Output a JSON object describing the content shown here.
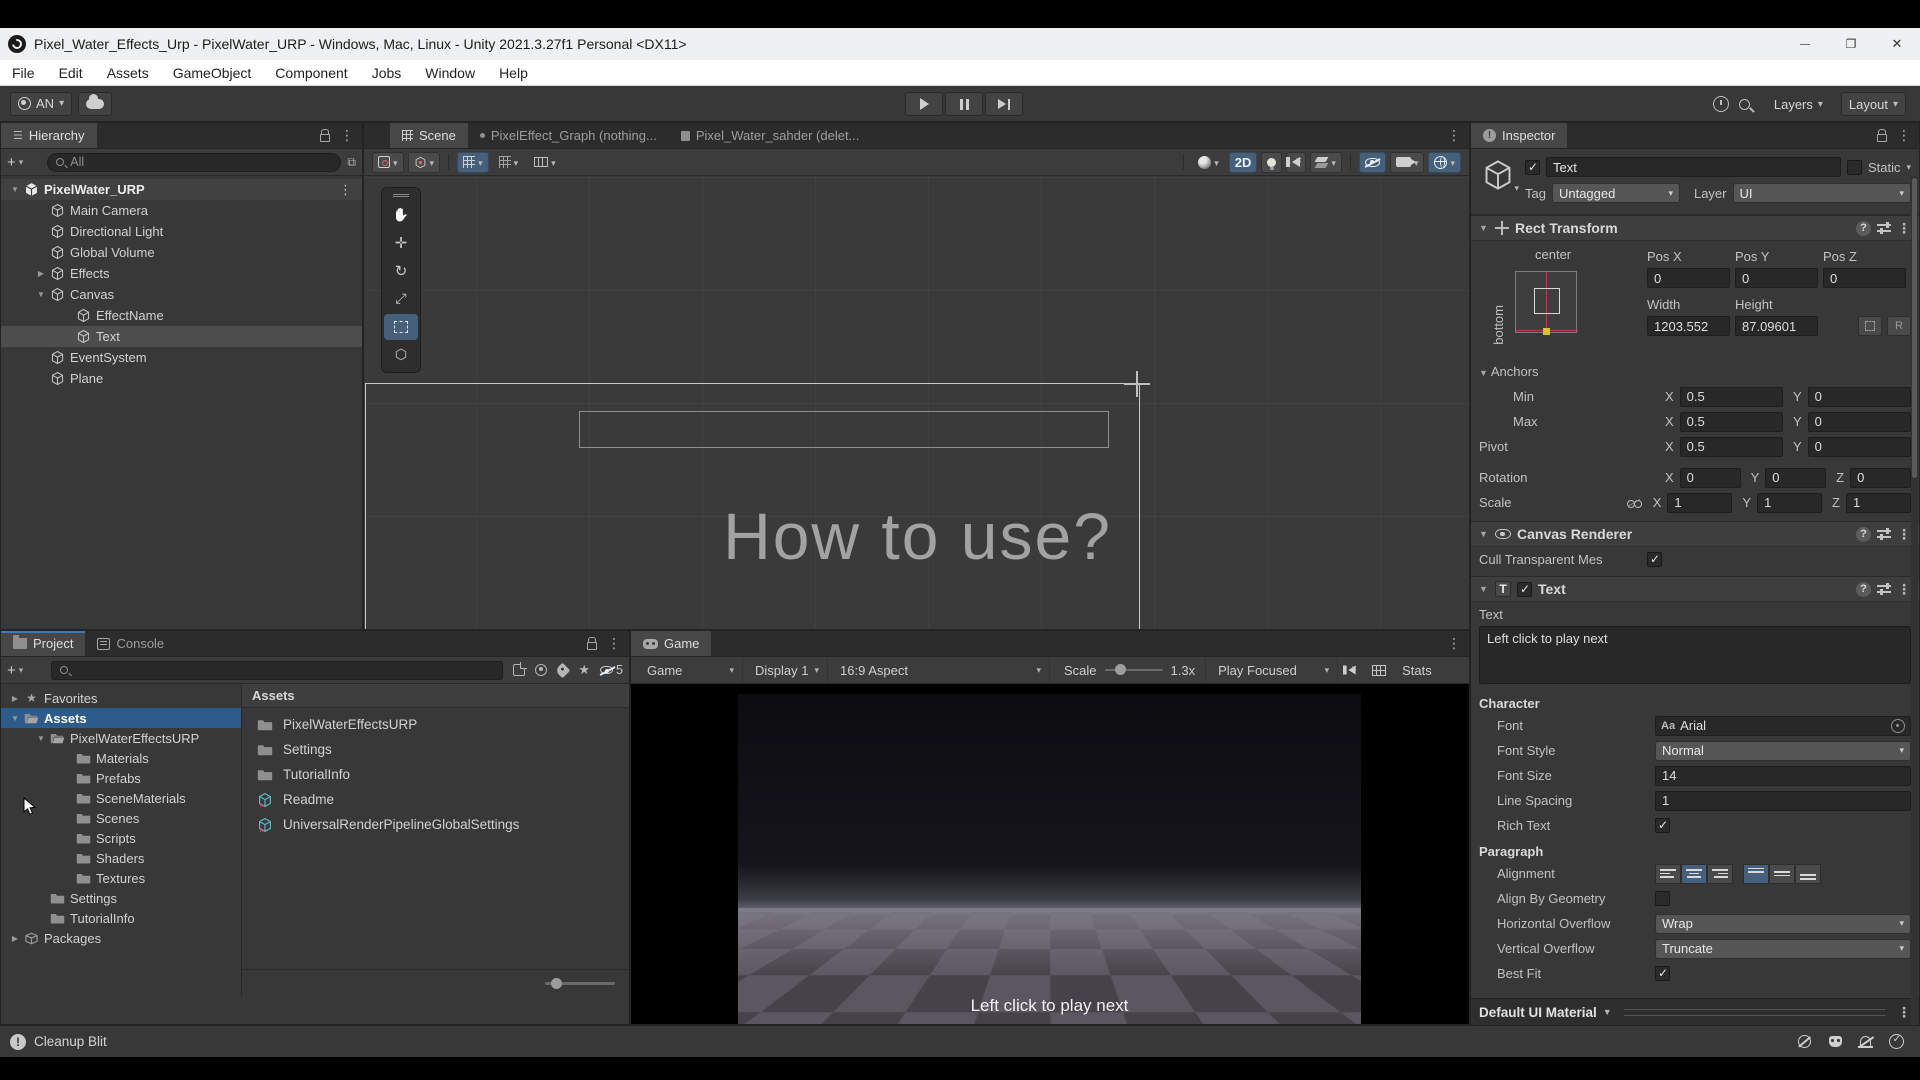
{
  "window": {
    "title": "Pixel_Water_Effects_Urp - PixelWater_URP - Windows, Mac, Linux - Unity 2021.3.27f1 Personal <DX11>"
  },
  "menu": {
    "items": [
      {
        "label": "File"
      },
      {
        "label": "Edit"
      },
      {
        "label": "Assets"
      },
      {
        "label": "GameObject"
      },
      {
        "label": "Component"
      },
      {
        "label": "Jobs"
      },
      {
        "label": "Window"
      },
      {
        "label": "Help"
      }
    ]
  },
  "toolbar": {
    "account_label": "AN",
    "layers_label": "Layers",
    "layout_label": "Layout"
  },
  "hierarchy": {
    "tab_label": "Hierarchy",
    "search_placeholder": "All",
    "items": [
      {
        "label": "PixelWater_URP",
        "depth": 0,
        "expand": "open",
        "icon": "scene",
        "state": "scene-row"
      },
      {
        "label": "Main Camera",
        "depth": 1,
        "expand": "none",
        "icon": "cube",
        "state": ""
      },
      {
        "label": "Directional Light",
        "depth": 1,
        "expand": "none",
        "icon": "cube",
        "state": ""
      },
      {
        "label": "Global Volume",
        "depth": 1,
        "expand": "none",
        "icon": "cube",
        "state": ""
      },
      {
        "label": "Effects",
        "depth": 1,
        "expand": "closed",
        "icon": "cube",
        "state": ""
      },
      {
        "label": "Canvas",
        "depth": 1,
        "expand": "open",
        "icon": "cube",
        "state": ""
      },
      {
        "label": "EffectName",
        "depth": 2,
        "expand": "none",
        "icon": "cube",
        "state": ""
      },
      {
        "label": "Text",
        "depth": 2,
        "expand": "none",
        "icon": "cube",
        "state": "selected"
      },
      {
        "label": "EventSystem",
        "depth": 1,
        "expand": "none",
        "icon": "cube",
        "state": ""
      },
      {
        "label": "Plane",
        "depth": 1,
        "expand": "none",
        "icon": "cube",
        "state": ""
      }
    ]
  },
  "scene": {
    "tabs": [
      {
        "label": "Scene"
      },
      {
        "label": "PixelEffect_Graph (nothing..."
      },
      {
        "label": "Pixel_Water_sahder (delet..."
      }
    ],
    "toolbar": {
      "mode_2d_label": "2D"
    },
    "canvas_text": "How to use?"
  },
  "inspector": {
    "tab_label": "Inspector",
    "header": {
      "name_value": "Text",
      "static_label": "Static",
      "tag_label": "Tag",
      "tag_value": "Untagged",
      "layer_label": "Layer",
      "layer_value": "UI"
    },
    "axis": {
      "x": "X",
      "y": "Y",
      "z": "Z"
    },
    "rect_transform": {
      "title": "Rect Transform",
      "anchor_center_label": "center",
      "anchor_bottom_label": "bottom",
      "pos_x_label": "Pos X",
      "pos_y_label": "Pos Y",
      "pos_z_label": "Pos Z",
      "pos_x": "0",
      "pos_y": "0",
      "pos_z": "0",
      "width_label": "Width",
      "height_label": "Height",
      "width": "1203.552",
      "height": "87.09601",
      "raw_button_label": "R",
      "anchors_label": "Anchors",
      "min_label": "Min",
      "min_x": "0.5",
      "min_y": "0",
      "max_label": "Max",
      "max_x": "0.5",
      "max_y": "0",
      "pivot_label": "Pivot",
      "pivot_x": "0.5",
      "pivot_y": "0",
      "rotation_label": "Rotation",
      "rot_x": "0",
      "rot_y": "0",
      "rot_z": "0",
      "scale_label": "Scale",
      "scale_x": "1",
      "scale_y": "1",
      "scale_z": "1"
    },
    "canvas_renderer": {
      "title": "Canvas Renderer",
      "cull_label": "Cull Transparent Mes"
    },
    "text_component": {
      "title": "Text",
      "text_label": "Text",
      "text_value": "Left click to play next",
      "character_label": "Character",
      "font_label": "Font",
      "font_badge": "Aa",
      "font_value": "Arial",
      "font_style_label": "Font Style",
      "font_style_value": "Normal",
      "font_size_label": "Font Size",
      "font_size_value": "14",
      "line_spacing_label": "Line Spacing",
      "line_spacing_value": "1",
      "rich_text_label": "Rich Text",
      "paragraph_label": "Paragraph",
      "alignment_label": "Alignment",
      "align_by_geometry_label": "Align By Geometry",
      "horizontal_overflow_label": "Horizontal Overflow",
      "horizontal_overflow_value": "Wrap",
      "vertical_overflow_label": "Vertical Overflow",
      "vertical_overflow_value": "Truncate",
      "best_fit_label": "Best Fit"
    },
    "material_bar_label": "Default UI Material"
  },
  "project": {
    "tab_label": "Project",
    "console_tab_label": "Console",
    "hidden_count": "5",
    "tree": [
      {
        "label": "Favorites",
        "depth": 0,
        "expand": "closed",
        "icon": "star",
        "state": ""
      },
      {
        "label": "Assets",
        "depth": 0,
        "expand": "open",
        "icon": "folder-open",
        "state": "selected-blue"
      },
      {
        "label": "PixelWaterEffectsURP",
        "depth": 1,
        "expand": "open",
        "icon": "folder-open",
        "state": ""
      },
      {
        "label": "Materials",
        "depth": 2,
        "expand": "none",
        "icon": "folder",
        "state": ""
      },
      {
        "label": "Prefabs",
        "depth": 2,
        "expand": "none",
        "icon": "folder",
        "state": ""
      },
      {
        "label": "SceneMaterials",
        "depth": 2,
        "expand": "none",
        "icon": "folder",
        "state": ""
      },
      {
        "label": "Scenes",
        "depth": 2,
        "expand": "none",
        "icon": "folder",
        "state": ""
      },
      {
        "label": "Scripts",
        "depth": 2,
        "expand": "none",
        "icon": "folder",
        "state": ""
      },
      {
        "label": "Shaders",
        "depth": 2,
        "expand": "none",
        "icon": "folder",
        "state": ""
      },
      {
        "label": "Textures",
        "depth": 2,
        "expand": "none",
        "icon": "folder",
        "state": ""
      },
      {
        "label": "Settings",
        "depth": 1,
        "expand": "none",
        "icon": "folder",
        "state": ""
      },
      {
        "label": "TutorialInfo",
        "depth": 1,
        "expand": "none",
        "icon": "folder",
        "state": ""
      },
      {
        "label": "Packages",
        "depth": 0,
        "expand": "closed",
        "icon": "package",
        "state": ""
      }
    ],
    "pane_header": "Assets",
    "assets": [
      {
        "label": "PixelWaterEffectsURP",
        "icon": "folder"
      },
      {
        "label": "Settings",
        "icon": "folder"
      },
      {
        "label": "TutorialInfo",
        "icon": "folder"
      },
      {
        "label": "Readme",
        "icon": "scriptable"
      },
      {
        "label": "UniversalRenderPipelineGlobalSettings",
        "icon": "scriptable"
      }
    ]
  },
  "game": {
    "tab_label": "Game",
    "toolbar": {
      "target_label": "Game",
      "display_label": "Display 1",
      "aspect_label": "16:9 Aspect",
      "scale_label": "Scale",
      "scale_value": "1.3x",
      "play_mode_label": "Play Focused",
      "stats_label": "Stats"
    },
    "caption": "Left click to play next"
  },
  "status_bar": {
    "message": "Cleanup Blit"
  }
}
